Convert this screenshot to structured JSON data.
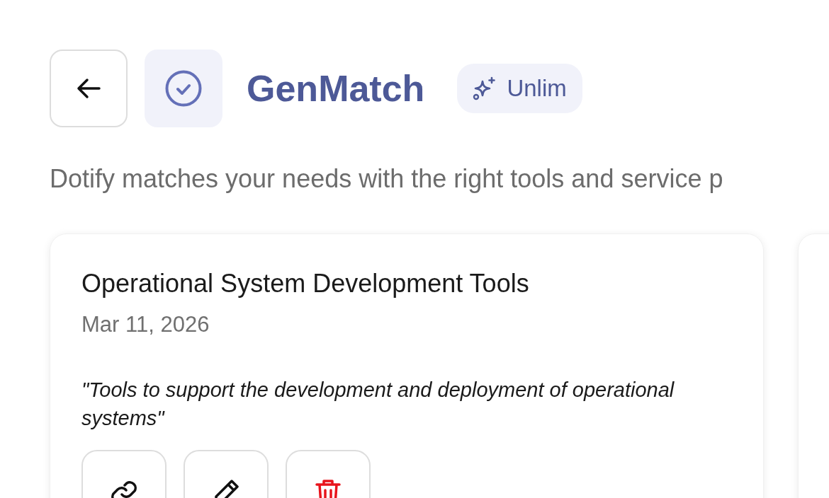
{
  "header": {
    "title": "GenMatch",
    "badge": "Unlim"
  },
  "subtitle": "Dotify matches your needs with the right tools and service p",
  "cards": [
    {
      "title": "Operational System Development Tools",
      "date": "Mar 11, 2026",
      "quote": "\"Tools to support the development and deployment of operational systems\"",
      "actions": [
        {
          "kind": "link"
        },
        {
          "kind": "edit"
        },
        {
          "kind": "delete"
        }
      ]
    }
  ]
}
